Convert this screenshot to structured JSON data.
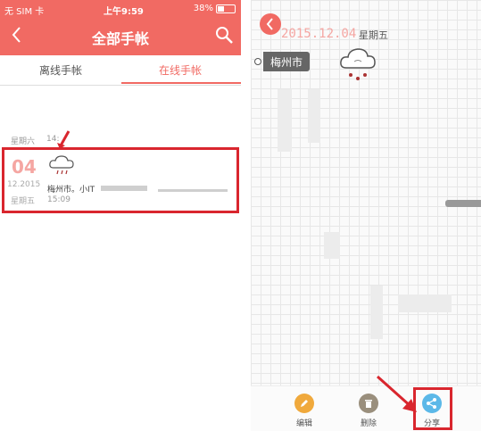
{
  "left_phone": {
    "status_bar": {
      "carrier": "无 SIM 卡",
      "time": "上午9:59",
      "battery_percent": "38%",
      "battery_level": 0.38
    },
    "nav": {
      "title": "全部手帐",
      "back_icon": "chevron-left-icon",
      "search_icon": "search-icon"
    },
    "tabs": [
      {
        "label": "离线手帐",
        "active": false
      },
      {
        "label": "在线手帐",
        "active": true
      }
    ],
    "prev_row": {
      "weekday": "星期六",
      "time": "14:"
    },
    "entry": {
      "day": "04",
      "month_year": "12.2015",
      "weekday": "星期五",
      "weather_icon": "rain-cloud-icon",
      "location_prefix": "梅州市。小IT",
      "time": "15:09"
    },
    "highlight_color": "#d9262e",
    "accent_color": "#f16a63"
  },
  "right_phone": {
    "date": "2015.12.04",
    "weekday": "星期五",
    "location": "梅州市",
    "weather_icon": "rain-cloud-icon",
    "toolbar": [
      {
        "label": "编辑",
        "icon": "pencil-icon",
        "color": "#f0a93c"
      },
      {
        "label": "删除",
        "icon": "trash-icon",
        "color": "#9a8f7d"
      },
      {
        "label": "分享",
        "icon": "share-icon",
        "color": "#5bb8e8"
      }
    ]
  }
}
